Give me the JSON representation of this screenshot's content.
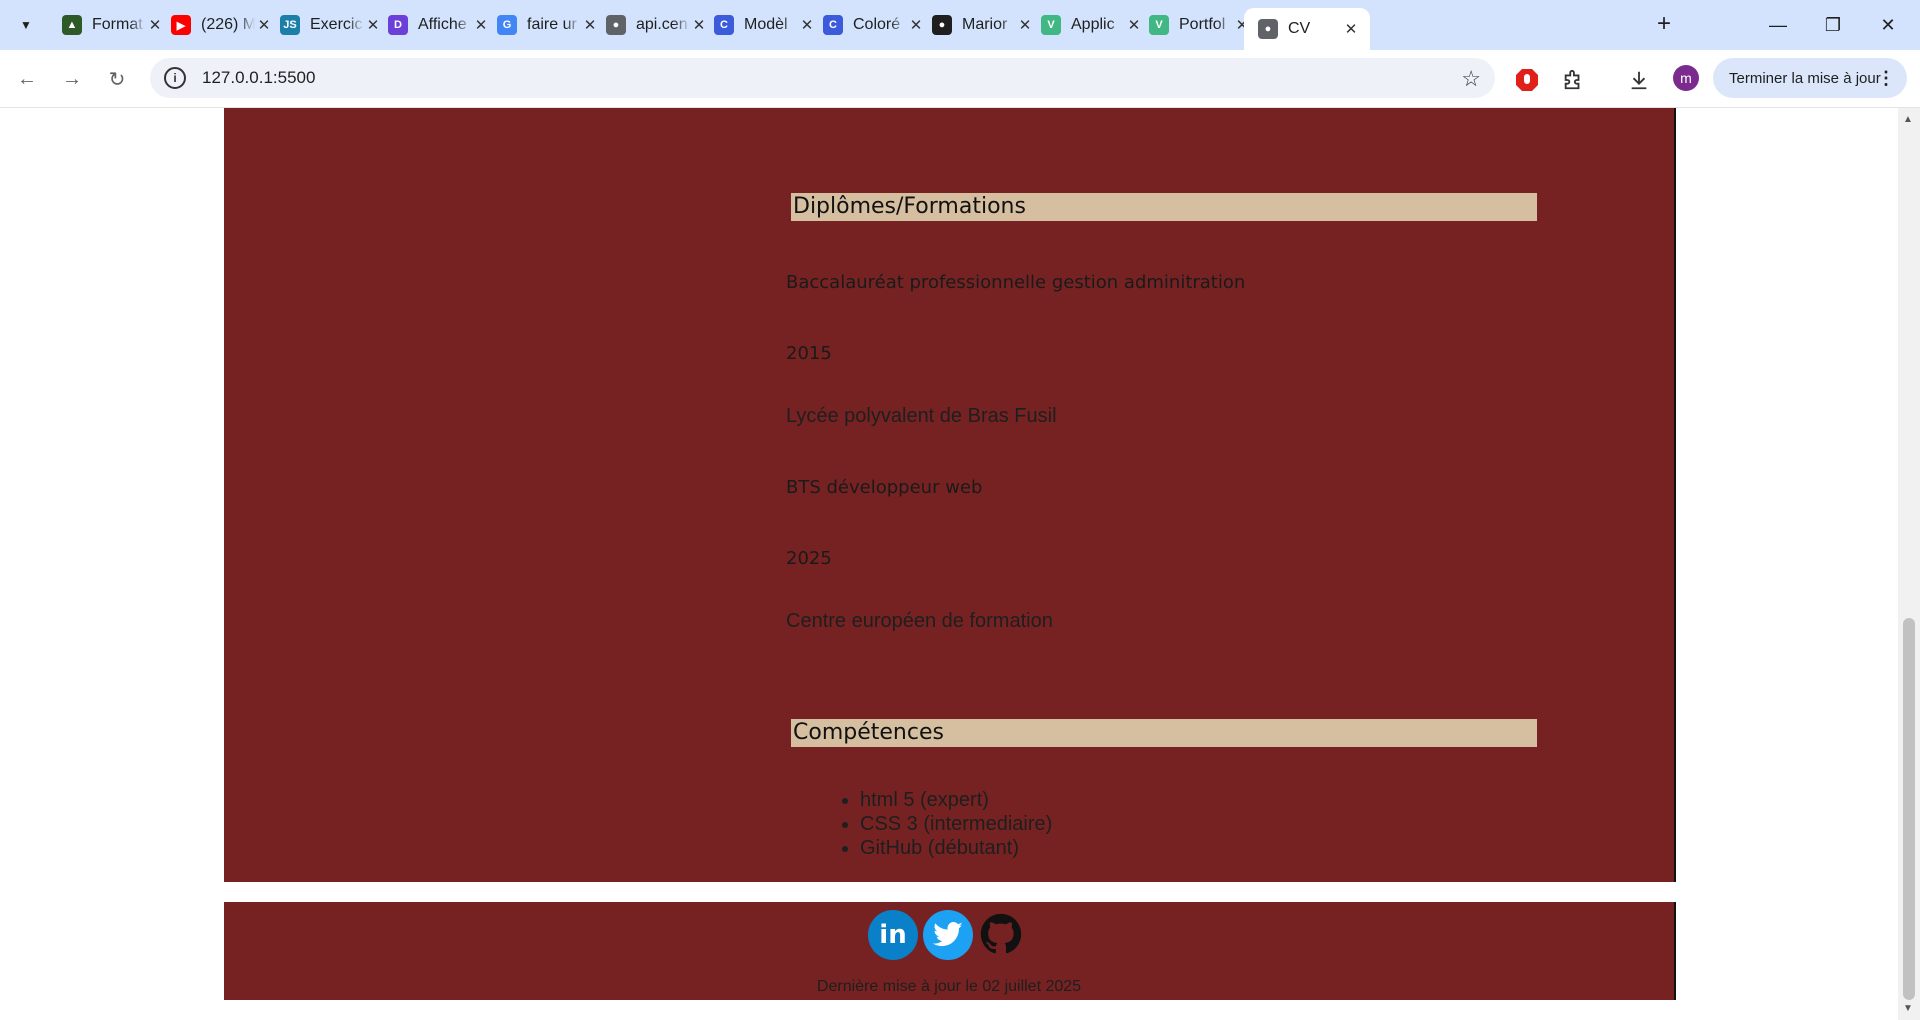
{
  "browser": {
    "tabs": [
      {
        "label": "Format",
        "icon": "format-icon",
        "color": "#2d5a27"
      },
      {
        "label": "(226) M",
        "icon": "youtube-icon",
        "color": "#ff0000"
      },
      {
        "label": "Exercic",
        "icon": "js-icon",
        "color": "#1b7fa8"
      },
      {
        "label": "Affiche",
        "icon": "dev-icon",
        "color": "#6b3fd8"
      },
      {
        "label": "faire ur",
        "icon": "google-icon",
        "color": "#4285f4"
      },
      {
        "label": "api.cen",
        "icon": "globe-icon",
        "color": "#5f6368"
      },
      {
        "label": "Modèl",
        "icon": "canva-icon",
        "color": "#3b5bdb"
      },
      {
        "label": "Coloré",
        "icon": "canva-icon",
        "color": "#3b5bdb"
      },
      {
        "label": "Marior",
        "icon": "github-icon",
        "color": "#1f1f1f"
      },
      {
        "label": "Applic",
        "icon": "vue-icon",
        "color": "#41b883"
      },
      {
        "label": "Portfol",
        "icon": "vue-icon",
        "color": "#41b883"
      },
      {
        "label": "CV",
        "icon": "globe-icon",
        "color": "#5f6368",
        "active": true
      }
    ],
    "url": "127.0.0.1:5500",
    "profile_initial": "m",
    "update_label": "Terminer la mise à jour"
  },
  "cv": {
    "education_title": "Diplômes/Formations",
    "education": [
      {
        "degree": "Baccalauréat professionnelle gestion adminitration",
        "year": "2015",
        "school": "Lycée polyvalent de Bras Fusil"
      },
      {
        "degree": "BTS développeur web",
        "year": "2025",
        "school": "Centre européen de formation"
      }
    ],
    "skills_title": "Compétences",
    "skills": [
      "html 5 (expert)",
      "CSS 3 (intermediaire)",
      "GitHub (débutant)"
    ],
    "footer": {
      "social": [
        "linkedin-icon",
        "twitter-icon",
        "github-icon"
      ],
      "linkedin_text": "in",
      "last_update": "Dernière mise à jour le 02 juillet 2025"
    },
    "colors": {
      "background": "#772222",
      "section_title_bg": "#d6bfa0"
    }
  }
}
